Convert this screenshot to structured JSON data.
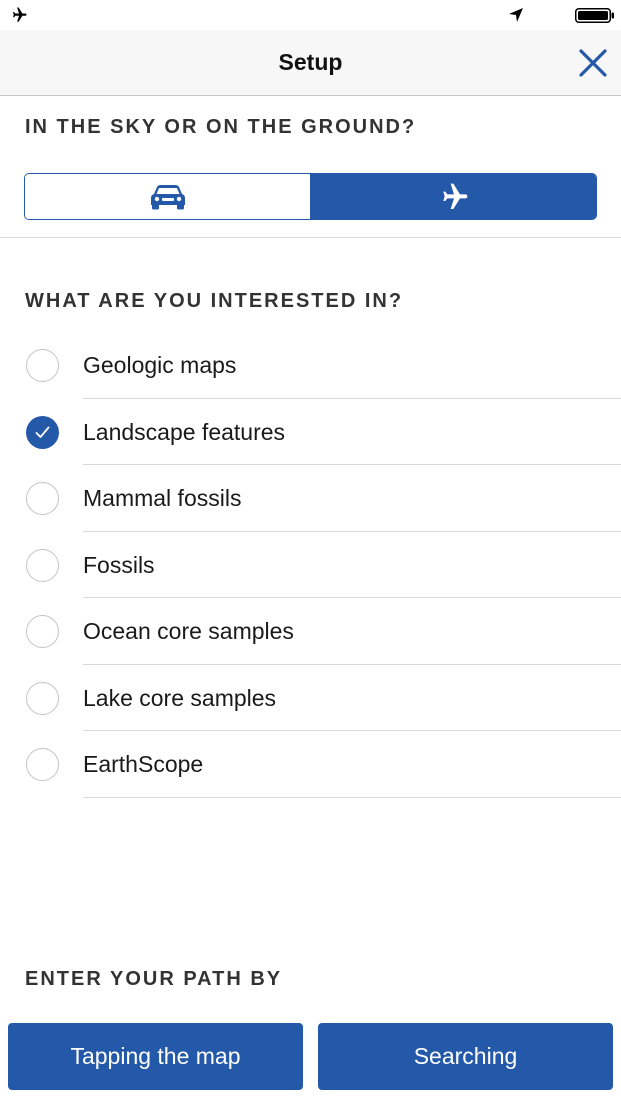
{
  "status_bar": {
    "airplane_icon": "airplane-icon",
    "location_icon": "location-arrow-icon",
    "battery_icon": "battery-icon"
  },
  "nav": {
    "title": "Setup",
    "close_icon": "close-icon"
  },
  "sky_or_ground": {
    "heading": "IN THE SKY OR ON THE GROUND?",
    "options": [
      {
        "icon": "car-icon",
        "selected": false
      },
      {
        "icon": "airplane-icon",
        "selected": true
      }
    ]
  },
  "interests": {
    "heading": "WHAT ARE YOU INTERESTED IN?",
    "items": [
      {
        "label": "Geologic maps",
        "checked": false
      },
      {
        "label": "Landscape features",
        "checked": true
      },
      {
        "label": "Mammal fossils",
        "checked": false
      },
      {
        "label": "Fossils",
        "checked": false
      },
      {
        "label": "Ocean core samples",
        "checked": false
      },
      {
        "label": "Lake core samples",
        "checked": false
      },
      {
        "label": "EarthScope",
        "checked": false
      }
    ]
  },
  "path": {
    "heading": "ENTER YOUR PATH BY",
    "tap_label": "Tapping the map",
    "search_label": "Searching"
  },
  "colors": {
    "accent": "#2458a8",
    "divider": "#d9d9d9",
    "nav_background": "#f7f7f7"
  }
}
